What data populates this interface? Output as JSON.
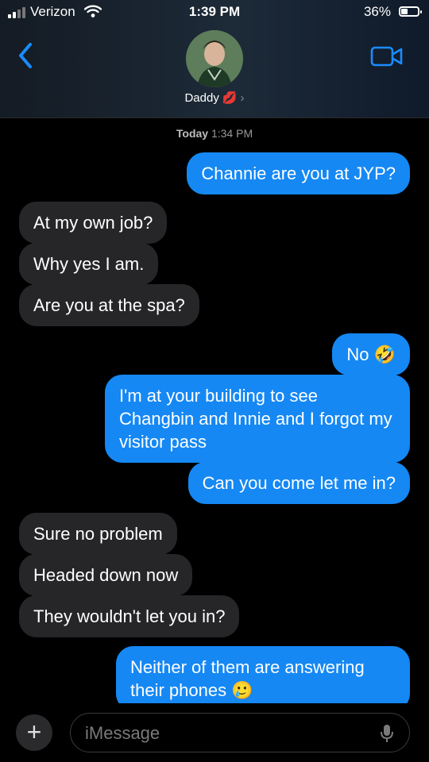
{
  "status_bar": {
    "carrier": "Verizon",
    "time": "1:39 PM",
    "battery_pct": "36%",
    "battery_level": 0.36
  },
  "header": {
    "contact_name": "Daddy",
    "contact_emoji": "💋",
    "chevron": "›",
    "back_icon": "chevron-left-icon",
    "video_icon": "video-camera-icon"
  },
  "conversation": {
    "timestamp_day": "Today",
    "timestamp_time": "1:34 PM",
    "messages": [
      {
        "from": "me",
        "text": "Channie are you at JYP?"
      },
      {
        "from": "them",
        "text": "At my own job?"
      },
      {
        "from": "them",
        "text": "Why yes I am."
      },
      {
        "from": "them",
        "text": "Are you at the spa?"
      },
      {
        "from": "me",
        "text": "No 🤣"
      },
      {
        "from": "me",
        "text": "I'm at your building to see Changbin and Innie and I forgot my visitor pass"
      },
      {
        "from": "me",
        "text": "Can you come let me in?"
      },
      {
        "from": "them",
        "text": "Sure no problem"
      },
      {
        "from": "them",
        "text": "Headed down now"
      },
      {
        "from": "them",
        "text": "They wouldn't let you in?"
      },
      {
        "from": "me",
        "text": "Neither of them are answering their phones 🥲"
      }
    ]
  },
  "composer": {
    "plus_label": "+",
    "placeholder": "iMessage",
    "mic_icon": "microphone-icon"
  },
  "colors": {
    "sent_bubble": "#1588f4",
    "received_bubble": "#262628",
    "accent": "#1a8cff"
  }
}
